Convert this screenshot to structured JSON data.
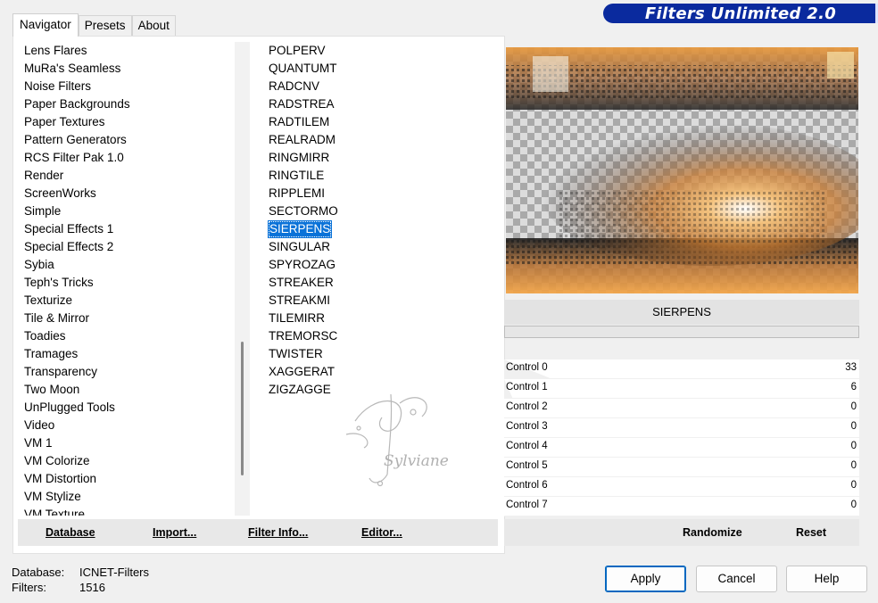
{
  "app": {
    "title": "Filters Unlimited 2.0"
  },
  "tabs": [
    {
      "label": "Navigator",
      "active": true
    },
    {
      "label": "Presets",
      "active": false
    },
    {
      "label": "About",
      "active": false
    }
  ],
  "categories": [
    "Lens Flares",
    "MuRa's Seamless",
    "Noise Filters",
    "Paper Backgrounds",
    "Paper Textures",
    "Pattern Generators",
    "RCS Filter Pak 1.0",
    "Render",
    "ScreenWorks",
    "Simple",
    "Special Effects 1",
    "Special Effects 2",
    "Sybia",
    "Teph's Tricks",
    "Texturize",
    "Tile & Mirror",
    "Toadies",
    "Tramages",
    "Transparency",
    "Two Moon",
    "UnPlugged Tools",
    "Video",
    "VM 1",
    "VM Colorize",
    "VM Distortion",
    "VM Stylize",
    "VM Texture"
  ],
  "filters": [
    "POLPERV",
    "QUANTUMT",
    "RADCNV",
    "RADSTREA",
    "RADTILEM",
    "REALRADM",
    "RINGMIRR",
    "RINGTILE",
    "RIPPLEMI",
    "SECTORMO",
    "SIERPENS",
    "SINGULAR",
    "SPYROZAG",
    "STREAKER",
    "STREAKMI",
    "TILEMIRR",
    "TREMORSC",
    "TWISTER",
    "XAGGERAT",
    "ZIGZAGGE"
  ],
  "selected_filter": "SIERPENS",
  "watermark_text": "Sylviane",
  "left_buttons": {
    "database": "Database",
    "import": "Import...",
    "filter_info": "Filter Info...",
    "editor": "Editor..."
  },
  "preview": {
    "filter_name": "SIERPENS"
  },
  "controls": [
    {
      "label": "Control 0",
      "value": 33
    },
    {
      "label": "Control 1",
      "value": 6
    },
    {
      "label": "Control 2",
      "value": 0
    },
    {
      "label": "Control 3",
      "value": 0
    },
    {
      "label": "Control 4",
      "value": 0
    },
    {
      "label": "Control 5",
      "value": 0
    },
    {
      "label": "Control 6",
      "value": 0
    },
    {
      "label": "Control 7",
      "value": 0
    }
  ],
  "control_max": 255,
  "right_buttons": {
    "randomize": "Randomize",
    "reset": "Reset"
  },
  "info": {
    "database_label": "Database:",
    "database_value": "ICNET-Filters",
    "filters_label": "Filters:",
    "filters_value": "1516"
  },
  "dialog_buttons": {
    "apply": "Apply",
    "cancel": "Cancel",
    "help": "Help"
  },
  "colors": {
    "banner": "#0a2a9e",
    "selection": "#0a72d8",
    "default_button_border": "#0067c0"
  }
}
